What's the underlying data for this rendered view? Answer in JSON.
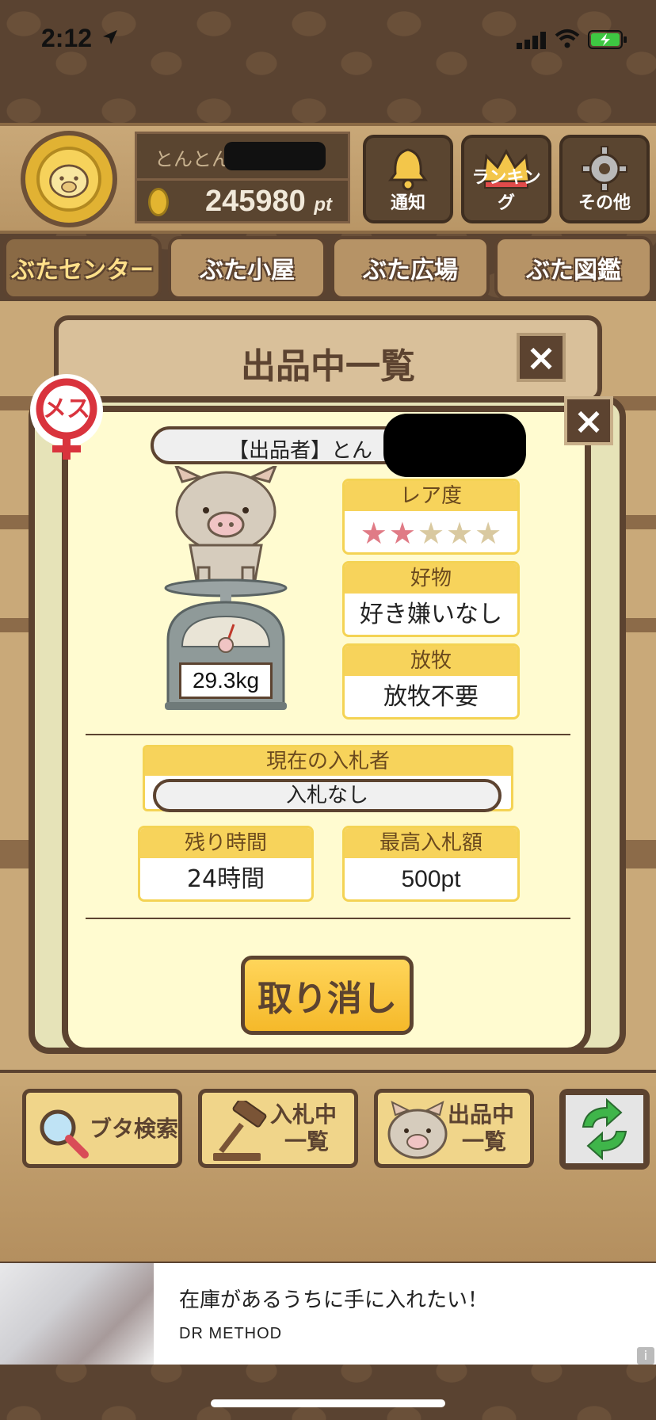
{
  "status_bar": {
    "time": "2:12"
  },
  "header": {
    "username": "とんとん",
    "points": "245980",
    "points_unit": "pt",
    "buttons": [
      {
        "label": "通知",
        "icon": "bell-icon"
      },
      {
        "label": "ランキング",
        "icon": "crown-icon"
      },
      {
        "label": "その他",
        "icon": "gear-icon"
      }
    ]
  },
  "tabs": [
    {
      "label": "ぶたセンター",
      "active": true
    },
    {
      "label": "ぶた小屋",
      "active": false
    },
    {
      "label": "ぶた広場",
      "active": false
    },
    {
      "label": "ぶた図鑑",
      "active": false
    }
  ],
  "modal": {
    "title": "出品中一覧",
    "close_glyph": "×",
    "gender": "メス",
    "seller_label": "【出品者】とん",
    "weight": "29.3kg",
    "rarity": {
      "label": "レア度",
      "filled": 2,
      "total": 5,
      "filled_color": "#e07b86",
      "empty_color": "#d9c9a0"
    },
    "favorite": {
      "label": "好物",
      "value": "好き嫌いなし"
    },
    "grazing": {
      "label": "放牧",
      "value": "放牧不要"
    },
    "current_bidder": {
      "label": "現在の入札者",
      "value": "入札なし"
    },
    "remaining_time": {
      "label": "残り時間",
      "value": "24時間"
    },
    "highest_bid": {
      "label": "最高入札額",
      "value": "500pt"
    },
    "cancel_label": "取り消し"
  },
  "toolbar": {
    "search_label": "ブタ検索",
    "bidding_label_1": "入札中",
    "bidding_label_2": "一覧",
    "listing_label_1": "出品中",
    "listing_label_2": "一覧"
  },
  "ad": {
    "title": "在庫があるうちに手に入れたい！",
    "sponsor": "DR METHOD",
    "info_glyph": "i"
  }
}
